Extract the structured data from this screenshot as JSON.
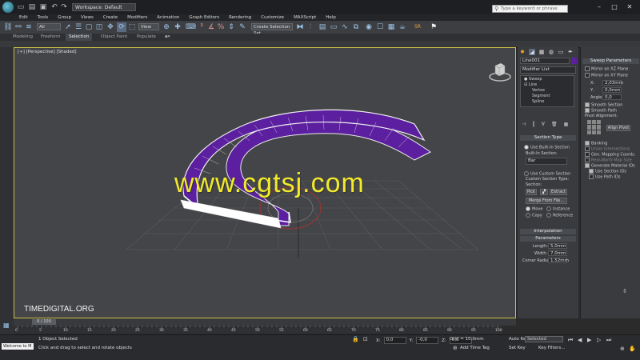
{
  "window": {
    "workspace": "Workspace: Default",
    "search_placeholder": "Type a keyword or phrase",
    "minimize": "–",
    "maximize": "□",
    "close": "✕"
  },
  "menu": [
    "Edit",
    "Tools",
    "Group",
    "Views",
    "Create",
    "Modifiers",
    "Animation",
    "Graph Editors",
    "Rendering",
    "Customize",
    "MAXScript",
    "Help"
  ],
  "toolbar": {
    "selection_filter": "All",
    "reference_coord": "View",
    "named_selection": "Create Selection Set",
    "sr_label": "SR"
  },
  "ribbon": {
    "tabs": [
      "Modeling",
      "Freeform",
      "Selection",
      "Object Paint",
      "Populate"
    ],
    "active": "Selection"
  },
  "viewport": {
    "label": "[+] [Perspective] [Shaded]",
    "watermark": "www.cgtsj.com",
    "brand": "TIMEDIGITAL.ORG"
  },
  "command_panel": {
    "object_name": "Line001",
    "modifier_list": "Modifier List",
    "stack": [
      "Sweep",
      "Line",
      "Vertex",
      "Segment",
      "Spline"
    ],
    "section_type": {
      "title": "Section Type",
      "use_builtin": "Use Built-In Section",
      "builtin_label": "Built-In Section:",
      "builtin_value": "Bar",
      "use_custom": "Use Custom Section",
      "custom_type": "Custom Section Type:",
      "section_label": "Section:",
      "pick": "Pick",
      "extract": "Extract",
      "merge": "Merge From File...",
      "move": "Move",
      "instance": "Instance",
      "copy": "Copy",
      "reference": "Reference"
    },
    "interpolation": "Interpolation",
    "parameters": {
      "title": "Parameters",
      "length_label": "Length:",
      "length": "5,0mm",
      "width_label": "Width:",
      "width": "7,0mm",
      "corner_label": "Corner Radius:",
      "corner": "1,52mm"
    }
  },
  "sweep_params": {
    "title": "Sweep Parameters",
    "mirror_xz": "Mirror on XZ Plane",
    "mirror_xy": "Mirror on XY Plane",
    "x_label": "X:",
    "x": "2,03mm",
    "y_label": "Y:",
    "y": "0,0mm",
    "angle_label": "Angle:",
    "angle": "0,0",
    "smooth_section": "Smooth Section",
    "smooth_path": "Smooth Path",
    "pivot_alignment": "Pivot Alignment:",
    "align_pivot": "Align Pivot",
    "banking": "Banking",
    "union_intersections": "Union Intersections",
    "gen_mapping": "Gen. Mapping Coords.",
    "real_world": "Real-World Map Size",
    "gen_material": "Generate Material IDs",
    "use_section_ids": "Use Section IDs",
    "use_path_ids": "Use Path IDs"
  },
  "timeline": {
    "slider": "0 / 100",
    "ticks": [
      "0",
      "5",
      "10",
      "15",
      "20",
      "25",
      "30",
      "35",
      "40",
      "45",
      "50",
      "55",
      "60",
      "65",
      "70",
      "75",
      "80",
      "85",
      "90",
      "95",
      "100"
    ]
  },
  "status": {
    "maxscript": "Welcome to M",
    "line1": "1 Object Selected",
    "line2": "Click and drag to select and rotate objects",
    "x_label": "X:",
    "x": "0,0",
    "y_label": "Y:",
    "y": "-0,0",
    "z_label": "Z:",
    "z": "0,0",
    "grid": "Grid = 10,0mm",
    "add_time_tag": "Add Time Tag",
    "auto_key": "Auto Key",
    "selected": "Selected",
    "set_key": "Set Key",
    "key_filters": "Key Filters..."
  },
  "colors": {
    "accent_yellow": "#c9c242",
    "sweep_purple": "#5b1fa0",
    "watermark_yellow": "#f2ea2a"
  }
}
